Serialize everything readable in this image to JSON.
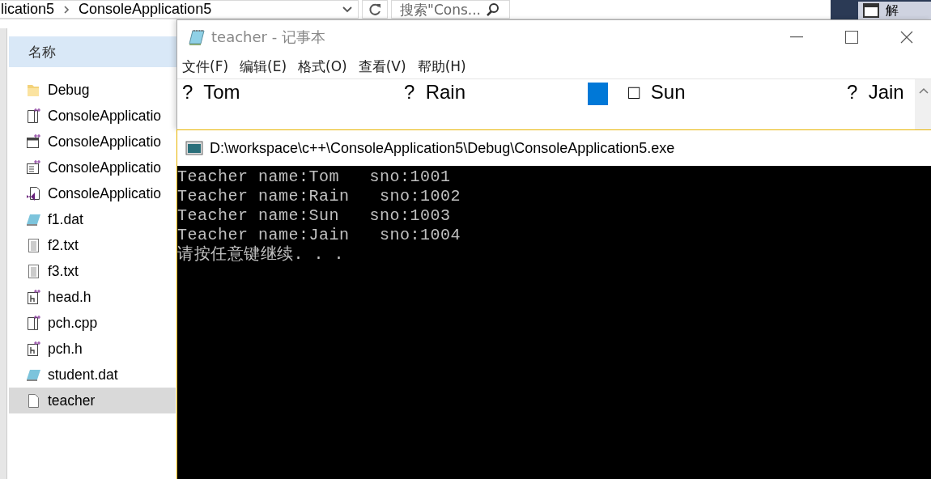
{
  "explorer": {
    "breadcrumb": [
      "lication5",
      "ConsoleApplication5"
    ],
    "search": {
      "placeholder": "搜索\"Cons..."
    },
    "column_header": "名称",
    "files": [
      {
        "name": "Debug",
        "kind": "folder",
        "selected": false
      },
      {
        "name": "ConsoleApplicatio",
        "kind": "cpp",
        "selected": false
      },
      {
        "name": "ConsoleApplicatio",
        "kind": "window",
        "selected": false
      },
      {
        "name": "ConsoleApplicatio",
        "kind": "resource",
        "selected": false
      },
      {
        "name": "ConsoleApplicatio",
        "kind": "vsproject",
        "selected": false
      },
      {
        "name": "f1.dat",
        "kind": "notepad",
        "selected": false
      },
      {
        "name": "f2.txt",
        "kind": "text",
        "selected": false
      },
      {
        "name": "f3.txt",
        "kind": "text",
        "selected": false
      },
      {
        "name": "head.h",
        "kind": "header",
        "selected": false
      },
      {
        "name": "pch.cpp",
        "kind": "cpp",
        "selected": false
      },
      {
        "name": "pch.h",
        "kind": "header",
        "selected": false
      },
      {
        "name": "student.dat",
        "kind": "notepad",
        "selected": false
      },
      {
        "name": "teacher",
        "kind": "blank",
        "selected": true
      }
    ]
  },
  "side_panel": {
    "label": "解"
  },
  "notepad": {
    "title": "teacher - 记事本",
    "menu": [
      "文件(F)",
      "编辑(E)",
      "格式(O)",
      "查看(V)",
      "帮助(H)"
    ],
    "content": [
      {
        "kind": "text",
        "text": "?  Tom"
      },
      {
        "kind": "text",
        "text": "?  Rain"
      },
      {
        "kind": "block"
      },
      {
        "kind": "text",
        "text": "□  Sun"
      },
      {
        "kind": "text",
        "text": "?  Jain"
      }
    ]
  },
  "console": {
    "title": "D:\\workspace\\c++\\ConsoleApplication5\\Debug\\ConsoleApplication5.exe",
    "lines": [
      "Teacher name:Tom   sno:1001",
      "Teacher name:Rain   sno:1002",
      "Teacher name:Sun   sno:1003",
      "Teacher name:Jain   sno:1004",
      "请按任意键继续. . ."
    ]
  }
}
